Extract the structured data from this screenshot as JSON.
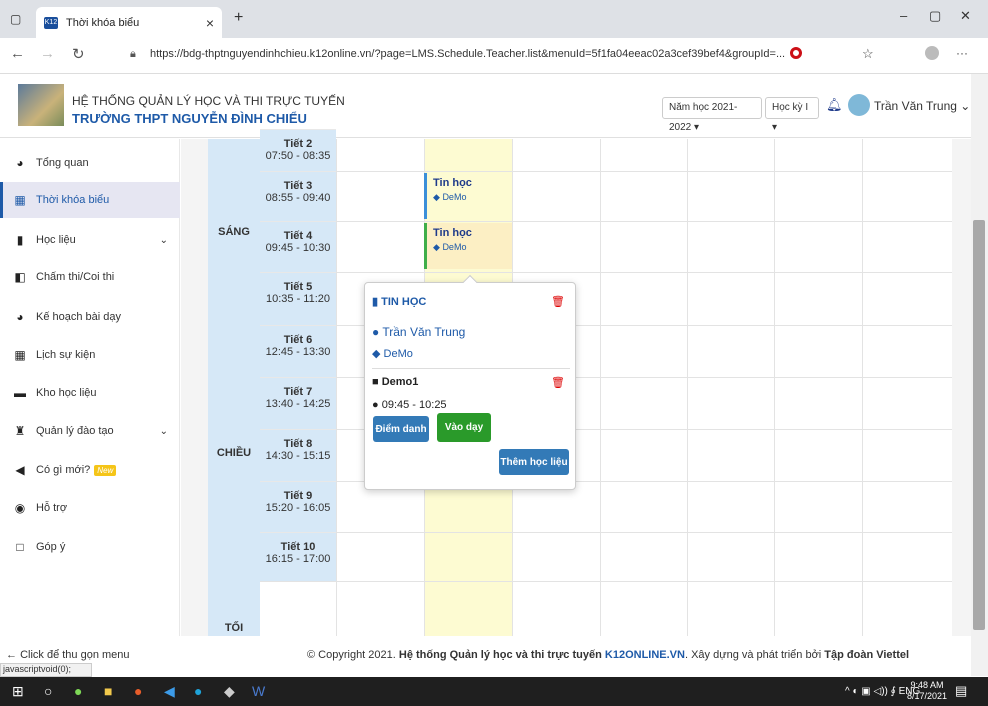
{
  "browser": {
    "tab_title": "Thời khóa biểu",
    "tab_favicon": "K12",
    "url": "https://bdg-thptnguyendinhchieu.k12online.vn/?page=LMS.Schedule.Teacher.list&menuId=5f1fa04eeac02a3cef39bef4&groupId=..."
  },
  "header": {
    "system": "HỆ THỐNG QUẢN LÝ HỌC VÀ THI TRỰC TUYẾN",
    "school": "TRƯỜNG THPT NGUYỄN ĐÌNH CHIỂU",
    "year": "Năm học 2021-2022",
    "term": "Học kỳ I",
    "user": "Trần Văn Trung"
  },
  "sidebar": {
    "items": [
      {
        "label": "Tổng quan",
        "icon": "dashboard-icon"
      },
      {
        "label": "Thời khóa biểu",
        "icon": "calendar-icon"
      },
      {
        "label": "Học liệu",
        "icon": "books-icon"
      },
      {
        "label": "Chấm thi/Coi thi",
        "icon": "grading-icon"
      },
      {
        "label": "Kế hoạch bài dạy",
        "icon": "plan-icon"
      },
      {
        "label": "Lịch sự kiện",
        "icon": "calendar-icon"
      },
      {
        "label": "Kho học liệu",
        "icon": "library-icon"
      },
      {
        "label": "Quản lý đào tạo",
        "icon": "training-icon"
      },
      {
        "label": "Có gì mới?",
        "icon": "megaphone-icon",
        "badge": "New"
      },
      {
        "label": "Hỗ trợ",
        "icon": "support-icon"
      },
      {
        "label": "Góp ý",
        "icon": "feedback-icon"
      }
    ],
    "collapse": "Click để thu gọn menu"
  },
  "schedule": {
    "sessions": [
      "SÁNG",
      "CHIỀU",
      "TỐI"
    ],
    "periods": [
      {
        "name": "Tiết 2",
        "time": "07:50 - 08:35"
      },
      {
        "name": "Tiết 3",
        "time": "08:55 - 09:40"
      },
      {
        "name": "Tiết 4",
        "time": "09:45 - 10:30"
      },
      {
        "name": "Tiết 5",
        "time": "10:35 - 11:20"
      },
      {
        "name": "Tiết 6",
        "time": "12:45 - 13:30"
      },
      {
        "name": "Tiết 7",
        "time": "13:40 - 14:25"
      },
      {
        "name": "Tiết 8",
        "time": "14:30 - 15:15"
      },
      {
        "name": "Tiết 9",
        "time": "15:20 - 16:05"
      },
      {
        "name": "Tiết 10",
        "time": "16:15 - 17:00"
      }
    ],
    "events": [
      {
        "subject": "Tin học",
        "class": "DeMo"
      },
      {
        "subject": "Tin học",
        "class": "DeMo"
      }
    ]
  },
  "popup": {
    "subject": "TIN HỌC",
    "teacher": "Trần Văn Trung",
    "class": "DeMo",
    "lesson": "Demo1",
    "time": "09:45 - 10:25",
    "attendance": "Điểm danh",
    "enter": "Vào dạy",
    "add_material": "Thêm học liệu"
  },
  "footer": {
    "pre": "© Copyright 2021.",
    "name": "Hệ thống Quản lý học và thi trực tuyến",
    "site": "K12ONLINE.VN",
    "mid": ". Xây dựng và phát triển bởi",
    "org": "Tập đoàn Viettel"
  },
  "status": "javascriptvoid(0);",
  "taskbar": {
    "lang": "ENG",
    "time": "9:48 AM",
    "date": "8/17/2021"
  }
}
